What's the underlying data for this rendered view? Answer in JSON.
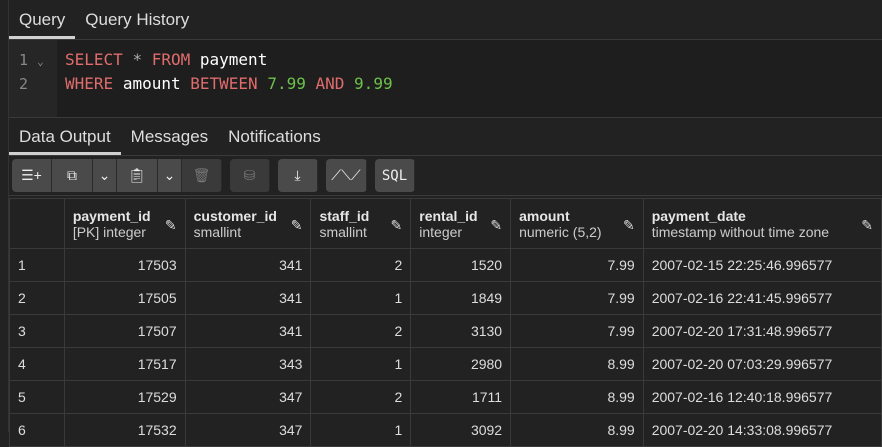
{
  "tabs": [
    {
      "label": "Query",
      "active": true
    },
    {
      "label": "Query History",
      "active": false
    }
  ],
  "editor": {
    "line_numbers": [
      "1",
      "2"
    ],
    "line1": {
      "k1": "SELECT",
      "op": "*",
      "k2": "FROM",
      "id": "payment"
    },
    "line2": {
      "k1": "WHERE",
      "id": "amount",
      "k2": "BETWEEN",
      "n1": "7.99",
      "k3": "AND",
      "n2": "9.99"
    }
  },
  "output_tabs": [
    {
      "label": "Data Output",
      "active": true
    },
    {
      "label": "Messages"
    },
    {
      "label": "Notifications"
    }
  ],
  "toolbar": {
    "sql_label": "SQL",
    "icons": [
      "add-row-icon",
      "copy-icon",
      "chevron-down-icon",
      "paste-icon",
      "chevron-down-icon",
      "delete-icon",
      "save-data-icon",
      "download-icon",
      "graph-icon",
      "sql-icon"
    ]
  },
  "columns": [
    {
      "name": "payment_id",
      "type": "[PK] integer"
    },
    {
      "name": "customer_id",
      "type": "smallint"
    },
    {
      "name": "staff_id",
      "type": "smallint"
    },
    {
      "name": "rental_id",
      "type": "integer"
    },
    {
      "name": "amount",
      "type": "numeric (5,2)"
    },
    {
      "name": "payment_date",
      "type": "timestamp without time zone"
    }
  ],
  "rows": [
    [
      "1",
      "17503",
      "341",
      "2",
      "1520",
      "7.99",
      "2007-02-15 22:25:46.996577"
    ],
    [
      "2",
      "17505",
      "341",
      "1",
      "1849",
      "7.99",
      "2007-02-16 22:41:45.996577"
    ],
    [
      "3",
      "17507",
      "341",
      "2",
      "3130",
      "7.99",
      "2007-02-20 17:31:48.996577"
    ],
    [
      "4",
      "17517",
      "343",
      "1",
      "2980",
      "8.99",
      "2007-02-20 07:03:29.996577"
    ],
    [
      "5",
      "17529",
      "347",
      "2",
      "1711",
      "8.99",
      "2007-02-16 12:40:18.996577"
    ],
    [
      "6",
      "17532",
      "347",
      "1",
      "3092",
      "8.99",
      "2007-02-20 14:33:08.996577"
    ]
  ]
}
